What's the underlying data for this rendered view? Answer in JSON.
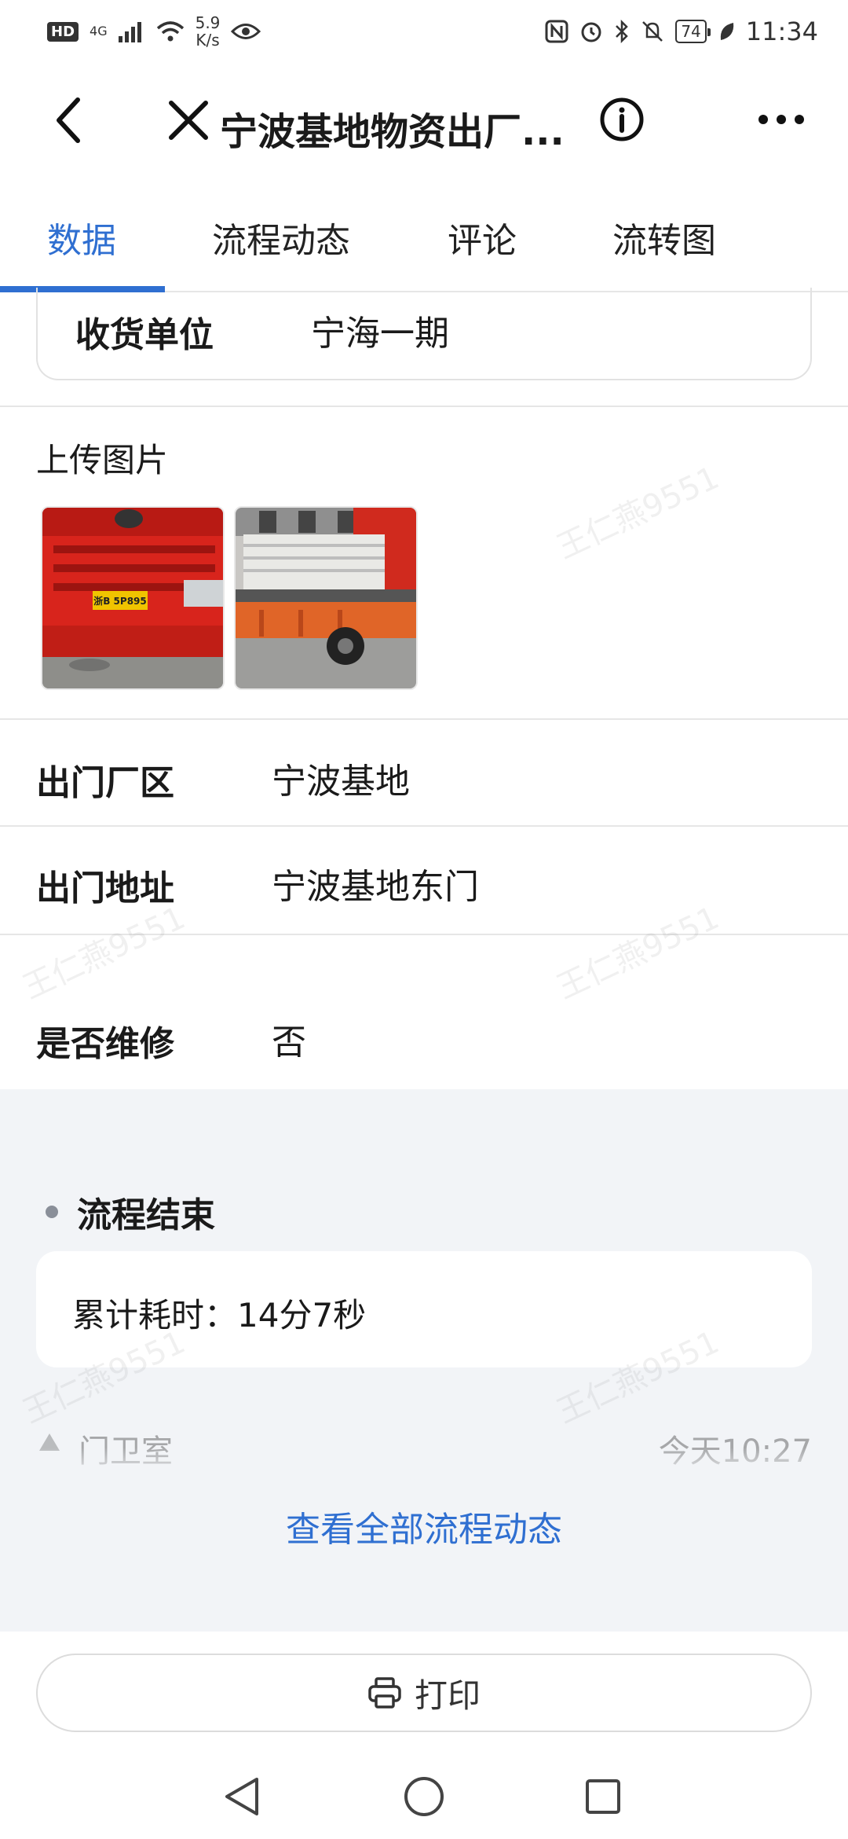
{
  "status_bar": {
    "network": "4G",
    "speed_value": "5.9",
    "speed_unit": "K/s",
    "hd_badge": "HD",
    "battery": "74",
    "time": "11:34"
  },
  "header": {
    "title": "宁波基地物资出厂...",
    "back_icon": "chevron-left-icon",
    "close_icon": "close-icon",
    "info_icon": "info-icon",
    "more_icon": "more-horizontal-icon"
  },
  "tabs": [
    {
      "label": "数据",
      "active": true
    },
    {
      "label": "流程动态",
      "active": false
    },
    {
      "label": "评论",
      "active": false
    },
    {
      "label": "流转图",
      "active": false
    }
  ],
  "form": {
    "consignee": {
      "label": "收货单位",
      "value": "宁海一期"
    },
    "upload_images": {
      "label": "上传图片",
      "plate_text": "浙B 5P895"
    },
    "exit_area": {
      "label": "出门厂区",
      "value": "宁波基地"
    },
    "exit_address": {
      "label": "出门地址",
      "value": "宁波基地东门"
    },
    "repair": {
      "label": "是否维修",
      "value": "否"
    }
  },
  "flow": {
    "status": "流程结束",
    "elapsed": "累计耗时：14分7秒",
    "prev_step_name": "门卫室",
    "prev_step_time": "今天10:27",
    "view_all": "查看全部流程动态"
  },
  "print": {
    "label": "打印",
    "icon": "printer-icon"
  },
  "watermark": "王仁燕9551",
  "colors": {
    "accent": "#2f6fd1",
    "section_bg": "#f2f4f7"
  }
}
